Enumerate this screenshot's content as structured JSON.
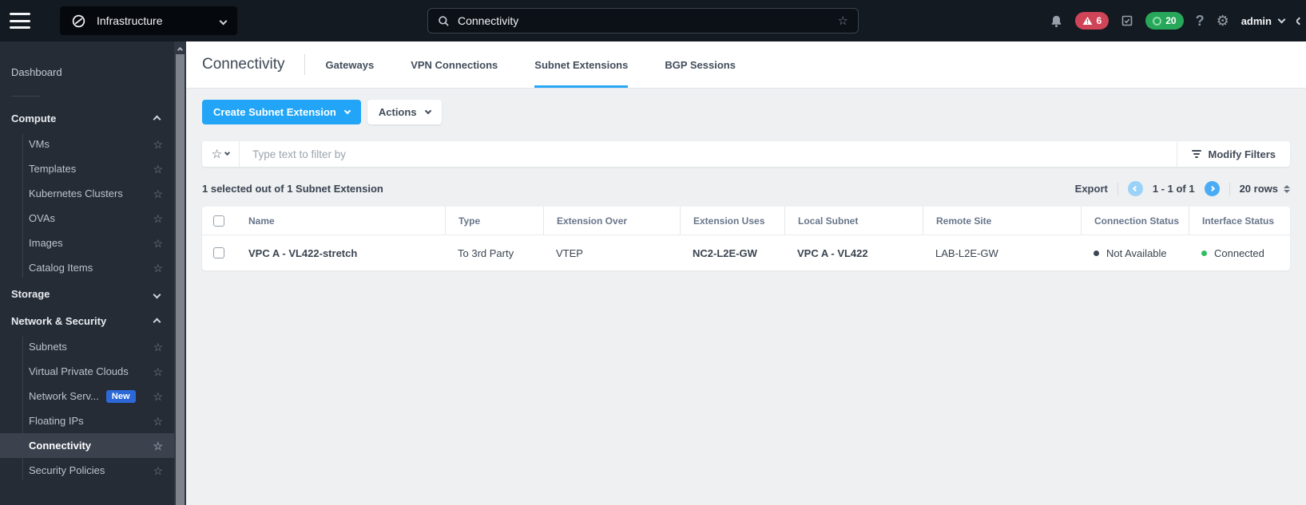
{
  "topbar": {
    "app_switcher_label": "Infrastructure",
    "search_value": "Connectivity",
    "alert_count": "6",
    "task_count": "20",
    "username": "admin"
  },
  "sidebar": {
    "dashboard": "Dashboard",
    "compute": {
      "label": "Compute",
      "items": [
        "VMs",
        "Templates",
        "Kubernetes Clusters",
        "OVAs",
        "Images",
        "Catalog Items"
      ]
    },
    "storage": {
      "label": "Storage"
    },
    "network": {
      "label": "Network & Security",
      "items": [
        "Subnets",
        "Virtual Private Clouds",
        "Network Serv...",
        "Floating IPs",
        "Connectivity",
        "Security Policies"
      ],
      "new_badge": "New",
      "selected_item": "Connectivity"
    }
  },
  "main": {
    "title": "Connectivity",
    "tabs": [
      {
        "label": "Gateways"
      },
      {
        "label": "VPN Connections"
      },
      {
        "label": "Subnet Extensions",
        "active": true
      },
      {
        "label": "BGP Sessions"
      }
    ],
    "create_button": "Create Subnet Extension",
    "actions_button": "Actions",
    "filter_placeholder": "Type text to filter by",
    "modify_filters_label": "Modify Filters",
    "selection_summary": "1 selected out of 1 Subnet Extension",
    "export_label": "Export",
    "pagination_range": "1 - 1 of 1",
    "rows_per_page": "20 rows",
    "table": {
      "columns": [
        "Name",
        "Type",
        "Extension Over",
        "Extension Uses",
        "Local Subnet",
        "Remote Site",
        "Connection Status",
        "Interface Status"
      ],
      "rows": [
        {
          "name": "VPC A - VL422-stretch",
          "type": "To 3rd Party",
          "extension_over": "VTEP",
          "extension_uses": "NC2-L2E-GW",
          "local_subnet": "VPC A - VL422",
          "remote_site": "LAB-L2E-GW",
          "connection_status": {
            "label": "Not Available",
            "color": "#3c4654"
          },
          "interface_status": {
            "label": "Connected",
            "color": "#2fbe63"
          }
        }
      ]
    },
    "colors": {
      "accent_blue": "#22a5f7"
    }
  }
}
